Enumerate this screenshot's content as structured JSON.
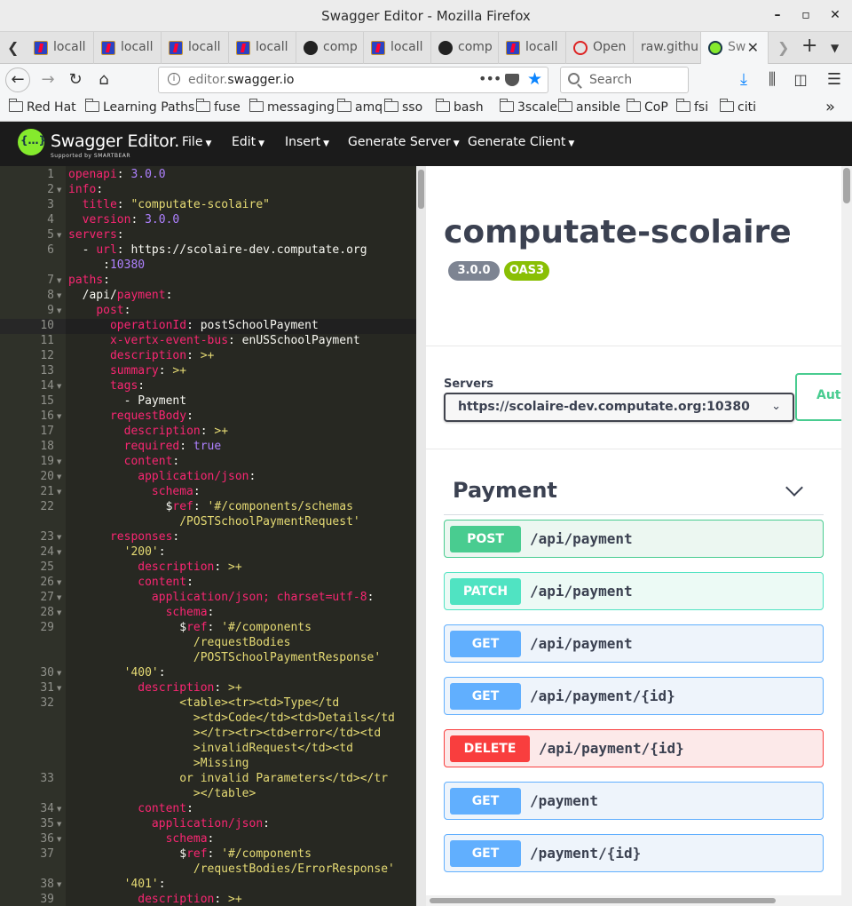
{
  "window": {
    "title": "Swagger Editor - Mozilla Firefox"
  },
  "tabs": [
    {
      "label": "locall",
      "icon": "jira"
    },
    {
      "label": "locall",
      "icon": "jira"
    },
    {
      "label": "locall",
      "icon": "jira"
    },
    {
      "label": "locall",
      "icon": "jira"
    },
    {
      "label": "comp",
      "icon": "github"
    },
    {
      "label": "locall",
      "icon": "jira"
    },
    {
      "label": "comp",
      "icon": "github"
    },
    {
      "label": "locall",
      "icon": "jira"
    },
    {
      "label": "Open",
      "icon": "redhat"
    },
    {
      "label": "raw.githu",
      "icon": ""
    },
    {
      "label": "Sw",
      "icon": "swagger"
    }
  ],
  "nav": {
    "url_prefix": "editor.",
    "url_domain": "swagger.io",
    "dots": "•••",
    "search_placeholder": "Search"
  },
  "bookmarks": [
    "Red Hat",
    "Learning Paths",
    "fuse",
    "messaging",
    "amq",
    "sso",
    "bash",
    "3scale",
    "ansible",
    "CoP",
    "fsi",
    "citi"
  ],
  "swagger": {
    "logo_text": "Swagger Editor.",
    "logo_sub": "Supported by SMARTBEAR",
    "menus": [
      "File",
      "Edit",
      "Insert",
      "Generate Server",
      "Generate Client"
    ]
  },
  "editor": {
    "lines": [
      {
        "n": "1",
        "fold": false,
        "segs": [
          [
            "k",
            "openapi"
          ],
          [
            "p",
            ": "
          ],
          [
            "n",
            "3.0.0"
          ]
        ]
      },
      {
        "n": "2",
        "fold": true,
        "segs": [
          [
            "k",
            "info"
          ],
          [
            "p",
            ":"
          ]
        ]
      },
      {
        "n": "3",
        "fold": false,
        "segs": [
          [
            "p",
            "  "
          ],
          [
            "k",
            "title"
          ],
          [
            "p",
            ": "
          ],
          [
            "s",
            "\"computate-scolaire\""
          ]
        ]
      },
      {
        "n": "4",
        "fold": false,
        "segs": [
          [
            "p",
            "  "
          ],
          [
            "k",
            "version"
          ],
          [
            "p",
            ": "
          ],
          [
            "n",
            "3.0.0"
          ]
        ]
      },
      {
        "n": "5",
        "fold": true,
        "segs": [
          [
            "k",
            "servers"
          ],
          [
            "p",
            ":"
          ]
        ]
      },
      {
        "n": "6",
        "fold": false,
        "segs": [
          [
            "p",
            "  - "
          ],
          [
            "k",
            "url"
          ],
          [
            "p",
            ": https://scolaire-dev.computate.org"
          ]
        ]
      },
      {
        "n": "",
        "fold": false,
        "segs": [
          [
            "p",
            "     :"
          ],
          [
            "n",
            "10380"
          ]
        ]
      },
      {
        "n": "7",
        "fold": true,
        "segs": [
          [
            "k",
            "paths"
          ],
          [
            "p",
            ":"
          ]
        ]
      },
      {
        "n": "8",
        "fold": true,
        "segs": [
          [
            "p",
            "  /api/"
          ],
          [
            "k",
            "payment"
          ],
          [
            "p",
            ":"
          ]
        ]
      },
      {
        "n": "9",
        "fold": true,
        "segs": [
          [
            "p",
            "    "
          ],
          [
            "k",
            "post"
          ],
          [
            "p",
            ":"
          ]
        ]
      },
      {
        "n": "10",
        "fold": false,
        "segs": [
          [
            "p",
            "      "
          ],
          [
            "k",
            "operationId"
          ],
          [
            "p",
            ": postSchoolPayment"
          ]
        ]
      },
      {
        "n": "11",
        "fold": false,
        "segs": [
          [
            "p",
            "      "
          ],
          [
            "k",
            "x-vertx-event-bus"
          ],
          [
            "p",
            ": enUSSchoolPayment"
          ]
        ]
      },
      {
        "n": "12",
        "fold": false,
        "segs": [
          [
            "p",
            "      "
          ],
          [
            "k",
            "description"
          ],
          [
            "p",
            ": "
          ],
          [
            "s",
            ">+"
          ]
        ]
      },
      {
        "n": "13",
        "fold": false,
        "segs": [
          [
            "p",
            "      "
          ],
          [
            "k",
            "summary"
          ],
          [
            "p",
            ": "
          ],
          [
            "s",
            ">+"
          ]
        ]
      },
      {
        "n": "14",
        "fold": true,
        "segs": [
          [
            "p",
            "      "
          ],
          [
            "k",
            "tags"
          ],
          [
            "p",
            ":"
          ]
        ]
      },
      {
        "n": "15",
        "fold": false,
        "segs": [
          [
            "p",
            "        - Payment"
          ]
        ]
      },
      {
        "n": "16",
        "fold": true,
        "segs": [
          [
            "p",
            "      "
          ],
          [
            "k",
            "requestBody"
          ],
          [
            "p",
            ":"
          ]
        ]
      },
      {
        "n": "17",
        "fold": false,
        "segs": [
          [
            "p",
            "        "
          ],
          [
            "k",
            "description"
          ],
          [
            "p",
            ": "
          ],
          [
            "s",
            ">+"
          ]
        ]
      },
      {
        "n": "18",
        "fold": false,
        "segs": [
          [
            "p",
            "        "
          ],
          [
            "k",
            "required"
          ],
          [
            "p",
            ": "
          ],
          [
            "n",
            "true"
          ]
        ]
      },
      {
        "n": "19",
        "fold": true,
        "segs": [
          [
            "p",
            "        "
          ],
          [
            "k",
            "content"
          ],
          [
            "p",
            ":"
          ]
        ]
      },
      {
        "n": "20",
        "fold": true,
        "segs": [
          [
            "p",
            "          "
          ],
          [
            "k",
            "application/json"
          ],
          [
            "p",
            ":"
          ]
        ]
      },
      {
        "n": "21",
        "fold": true,
        "segs": [
          [
            "p",
            "            "
          ],
          [
            "k",
            "schema"
          ],
          [
            "p",
            ":"
          ]
        ]
      },
      {
        "n": "22",
        "fold": false,
        "segs": [
          [
            "p",
            "              $"
          ],
          [
            "k",
            "ref"
          ],
          [
            "p",
            ": "
          ],
          [
            "s",
            "'#/components/schemas"
          ]
        ]
      },
      {
        "n": "",
        "fold": false,
        "segs": [
          [
            "s",
            "                /POSTSchoolPaymentRequest'"
          ]
        ]
      },
      {
        "n": "23",
        "fold": true,
        "segs": [
          [
            "p",
            "      "
          ],
          [
            "k",
            "responses"
          ],
          [
            "p",
            ":"
          ]
        ]
      },
      {
        "n": "24",
        "fold": true,
        "segs": [
          [
            "p",
            "        "
          ],
          [
            "s",
            "'200'"
          ],
          [
            "p",
            ":"
          ]
        ]
      },
      {
        "n": "25",
        "fold": false,
        "segs": [
          [
            "p",
            "          "
          ],
          [
            "k",
            "description"
          ],
          [
            "p",
            ": "
          ],
          [
            "s",
            ">+"
          ]
        ]
      },
      {
        "n": "26",
        "fold": true,
        "segs": [
          [
            "p",
            "          "
          ],
          [
            "k",
            "content"
          ],
          [
            "p",
            ":"
          ]
        ]
      },
      {
        "n": "27",
        "fold": true,
        "segs": [
          [
            "p",
            "            "
          ],
          [
            "k",
            "application/json; charset=utf-8"
          ],
          [
            "p",
            ":"
          ]
        ]
      },
      {
        "n": "28",
        "fold": true,
        "segs": [
          [
            "p",
            "              "
          ],
          [
            "k",
            "schema"
          ],
          [
            "p",
            ":"
          ]
        ]
      },
      {
        "n": "29",
        "fold": false,
        "segs": [
          [
            "p",
            "                $"
          ],
          [
            "k",
            "ref"
          ],
          [
            "p",
            ": "
          ],
          [
            "s",
            "'#/components"
          ]
        ]
      },
      {
        "n": "",
        "fold": false,
        "segs": [
          [
            "s",
            "                  /requestBodies"
          ]
        ]
      },
      {
        "n": "",
        "fold": false,
        "segs": [
          [
            "s",
            "                  /POSTSchoolPaymentResponse'"
          ]
        ]
      },
      {
        "n": "30",
        "fold": true,
        "segs": [
          [
            "p",
            "        "
          ],
          [
            "s",
            "'400'"
          ],
          [
            "p",
            ":"
          ]
        ]
      },
      {
        "n": "31",
        "fold": true,
        "segs": [
          [
            "p",
            "          "
          ],
          [
            "k",
            "description"
          ],
          [
            "p",
            ": "
          ],
          [
            "s",
            ">+"
          ]
        ]
      },
      {
        "n": "32",
        "fold": false,
        "segs": [
          [
            "s",
            "                <table><tr><td>Type</td"
          ]
        ]
      },
      {
        "n": "",
        "fold": false,
        "segs": [
          [
            "s",
            "                  ><td>Code</td><td>Details</td"
          ]
        ]
      },
      {
        "n": "",
        "fold": false,
        "segs": [
          [
            "s",
            "                  ></tr><tr><td>error</td><td"
          ]
        ]
      },
      {
        "n": "",
        "fold": false,
        "segs": [
          [
            "s",
            "                  >invalidRequest</td><td"
          ]
        ]
      },
      {
        "n": "",
        "fold": false,
        "segs": [
          [
            "s",
            "                  >Missing"
          ]
        ]
      },
      {
        "n": "33",
        "fold": false,
        "segs": [
          [
            "s",
            "                or invalid Parameters</td></tr"
          ]
        ]
      },
      {
        "n": "",
        "fold": false,
        "segs": [
          [
            "s",
            "                  ></table>"
          ]
        ]
      },
      {
        "n": "34",
        "fold": true,
        "segs": [
          [
            "p",
            "          "
          ],
          [
            "k",
            "content"
          ],
          [
            "p",
            ":"
          ]
        ]
      },
      {
        "n": "35",
        "fold": true,
        "segs": [
          [
            "p",
            "            "
          ],
          [
            "k",
            "application/json"
          ],
          [
            "p",
            ":"
          ]
        ]
      },
      {
        "n": "36",
        "fold": true,
        "segs": [
          [
            "p",
            "              "
          ],
          [
            "k",
            "schema"
          ],
          [
            "p",
            ":"
          ]
        ]
      },
      {
        "n": "37",
        "fold": false,
        "segs": [
          [
            "p",
            "                $"
          ],
          [
            "k",
            "ref"
          ],
          [
            "p",
            ": "
          ],
          [
            "s",
            "'#/components"
          ]
        ]
      },
      {
        "n": "",
        "fold": false,
        "segs": [
          [
            "s",
            "                  /requestBodies/ErrorResponse'"
          ]
        ]
      },
      {
        "n": "38",
        "fold": true,
        "segs": [
          [
            "p",
            "        "
          ],
          [
            "s",
            "'401'"
          ],
          [
            "p",
            ":"
          ]
        ]
      },
      {
        "n": "39",
        "fold": false,
        "segs": [
          [
            "p",
            "          "
          ],
          [
            "k",
            "description"
          ],
          [
            "p",
            ": "
          ],
          [
            "s",
            ">+"
          ]
        ]
      }
    ]
  },
  "preview": {
    "title": "computate-scolaire",
    "version": "3.0.0",
    "oas": "OAS3",
    "servers_label": "Servers",
    "server_selected": "https://scolaire-dev.computate.org:10380",
    "auth_label": "Aut",
    "tag": "Payment",
    "operations": [
      {
        "method": "POST",
        "path": "/api/payment",
        "kind": "post"
      },
      {
        "method": "PATCH",
        "path": "/api/payment",
        "kind": "patch"
      },
      {
        "method": "GET",
        "path": "/api/payment",
        "kind": "get"
      },
      {
        "method": "GET",
        "path": "/api/payment/{id}",
        "kind": "get"
      },
      {
        "method": "DELETE",
        "path": "/api/payment/{id}",
        "kind": "delete"
      },
      {
        "method": "GET",
        "path": "/payment",
        "kind": "get"
      },
      {
        "method": "GET",
        "path": "/payment/{id}",
        "kind": "get"
      }
    ]
  },
  "colors": {
    "post": "#49cc90",
    "patch": "#50e3c2",
    "get": "#61affe",
    "delete": "#f93e3e",
    "swagger_green": "#85ea2d",
    "version_badge": "#7d8492",
    "oas_badge": "#89bf04"
  }
}
